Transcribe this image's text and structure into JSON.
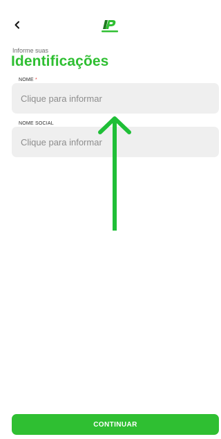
{
  "header": {
    "back_icon": "chevron-left-icon",
    "logo_icon": "brand-logo-icon",
    "brand_color": "#2fbf32"
  },
  "intro": {
    "subtitle": "Informe suas",
    "title": "Identificações"
  },
  "form": {
    "nome": {
      "label": "NOME",
      "required_mark": "*",
      "placeholder": "Clique para informar",
      "value": ""
    },
    "nome_social": {
      "label": "NOME SOCIAL",
      "placeholder": "Clique para informar",
      "value": ""
    }
  },
  "annotation": {
    "icon": "arrow-up-icon",
    "color": "#1fbf37"
  },
  "footer": {
    "continue_label": "CONTINUAR"
  }
}
